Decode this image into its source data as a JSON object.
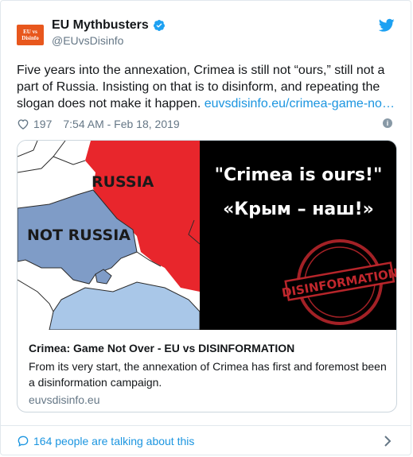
{
  "header": {
    "display_name": "EU Mythbusters",
    "handle": "@EUvsDisinfo",
    "avatar_line1": "EU vs",
    "avatar_line2": "Disinfo"
  },
  "tweet": {
    "text": "Five years into the annexation, Crimea is still not “ours,” still not a part of Russia. Insisting on that is to disinform, and repeating the slogan does not make it happen. ",
    "link_text": "euvsdisinfo.eu/crimea-game-no…",
    "like_count": "197",
    "timestamp": "7:54 AM - Feb 18, 2019"
  },
  "card": {
    "image": {
      "label_russia": "RUSSIA",
      "label_not_russia": "NOT RUSSIA",
      "quote_line1": "\"Crimea is ours!\"",
      "quote_line2": "«Крым – наш!»",
      "stamp_text": "DISINFORMATION"
    },
    "title": "Crimea: Game Not Over - EU vs DISINFORMATION",
    "description": "From its very start, the annexation of Crimea has first and foremost been a disinformation campaign.",
    "domain": "euvsdisinfo.eu"
  },
  "footer": {
    "talking_text": "164 people are talking about this"
  },
  "icons": {
    "verified": "verified-badge-icon",
    "twitter": "twitter-bird-icon",
    "heart": "heart-icon",
    "info": "info-icon",
    "comment": "speech-bubble-icon",
    "chevron": "chevron-right-icon"
  },
  "colors": {
    "link": "#1b95e0",
    "muted": "#657786",
    "russia_red": "#e8262c",
    "ukraine_blue": "#7f9cc7",
    "stamp_red": "#c0272d"
  }
}
